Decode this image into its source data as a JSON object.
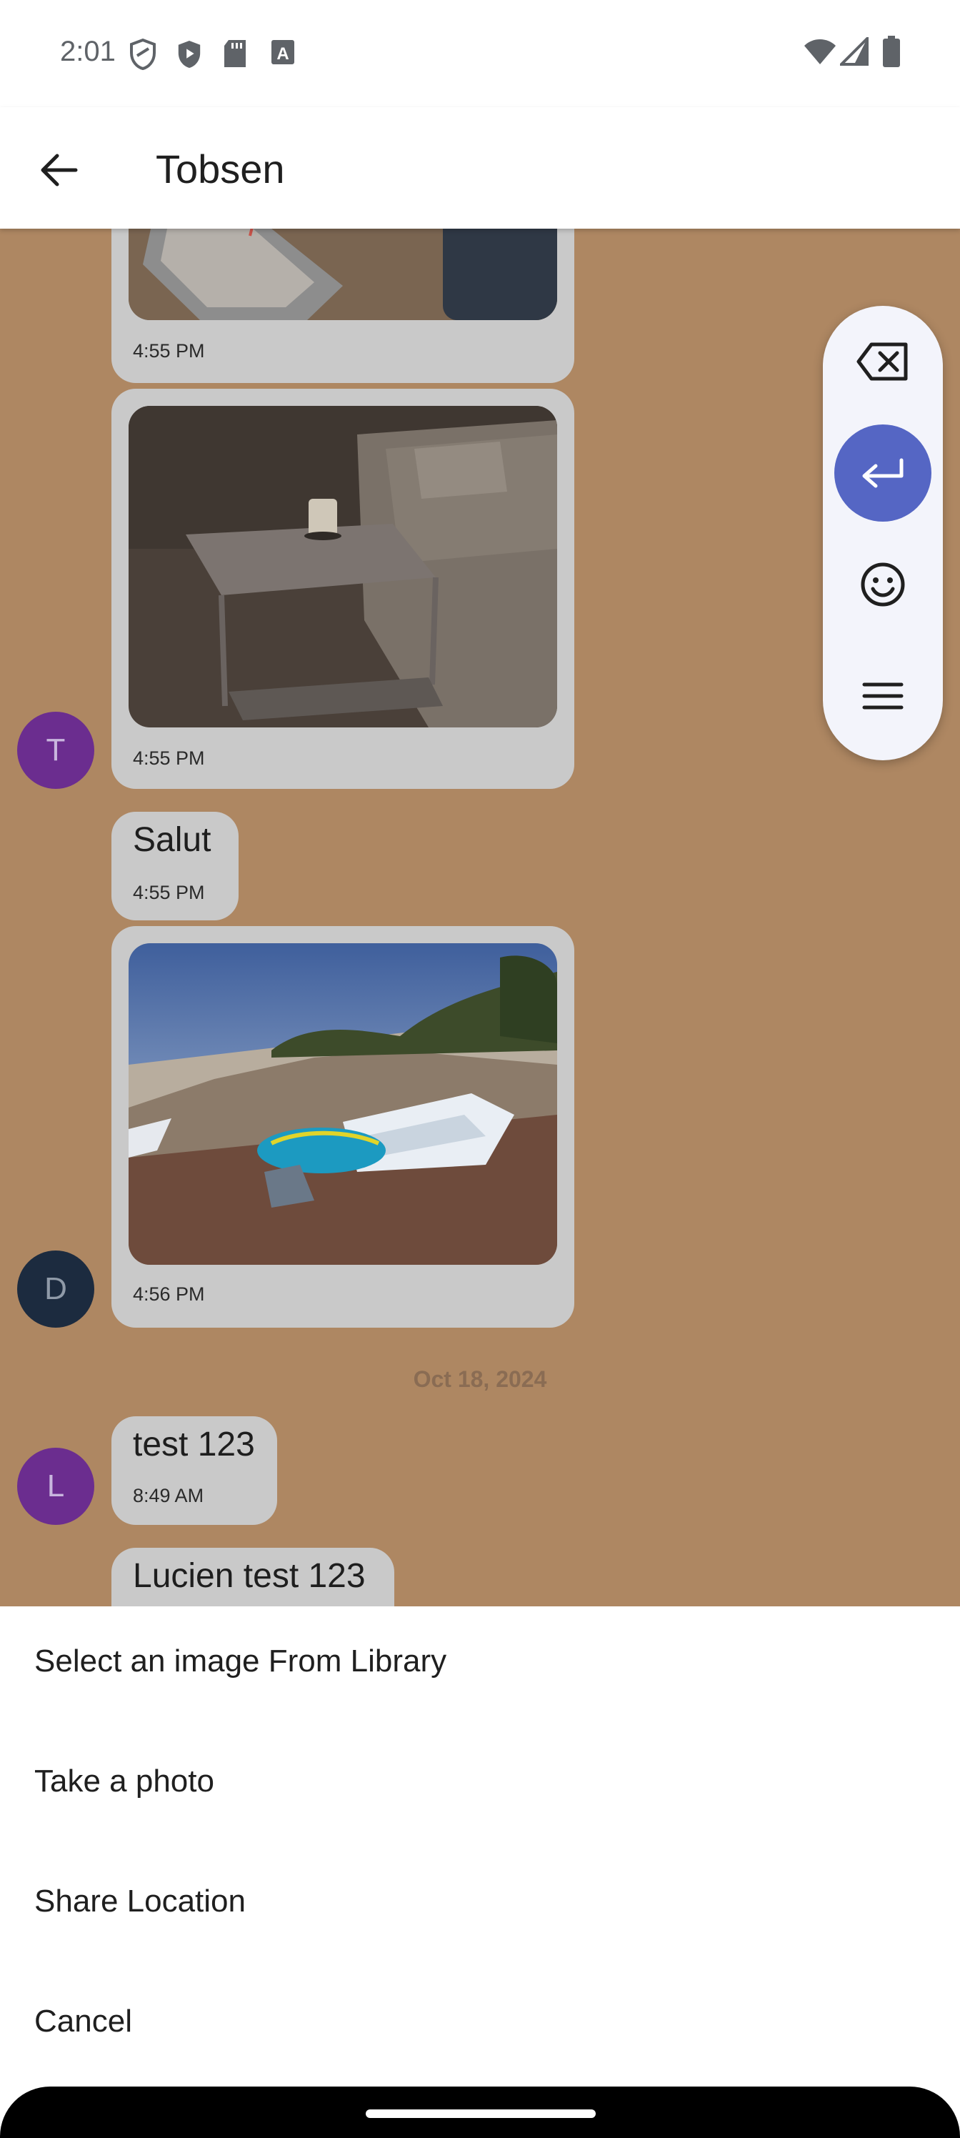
{
  "status_bar": {
    "time": "2:01"
  },
  "header": {
    "title": "Tobsen"
  },
  "messages": [
    {
      "time": "4:55 PM"
    },
    {
      "time": "4:55 PM"
    },
    {
      "text": "Salut",
      "time": "4:55 PM"
    },
    {
      "time": "4:56 PM"
    },
    {
      "text": "test 123",
      "time": "8:49 AM"
    },
    {
      "text": "Lucien test 123"
    }
  ],
  "avatars": {
    "first": "T",
    "second": "D",
    "third": "L"
  },
  "date_separator": "Oct 18, 2024",
  "colors": {
    "chat_background": "#ae8762",
    "bubble": "#c9c9c9",
    "avatar_purple": "#6b2d8f",
    "avatar_navy": "#1c2b3f",
    "accent": "#5566c4"
  },
  "keyboard_pill": {
    "icons": [
      "backspace-icon",
      "enter-icon",
      "emoji-icon",
      "menu-icon"
    ]
  },
  "sheet": {
    "options": [
      "Select an image From Library",
      "Take a photo",
      "Share Location",
      "Cancel"
    ]
  }
}
